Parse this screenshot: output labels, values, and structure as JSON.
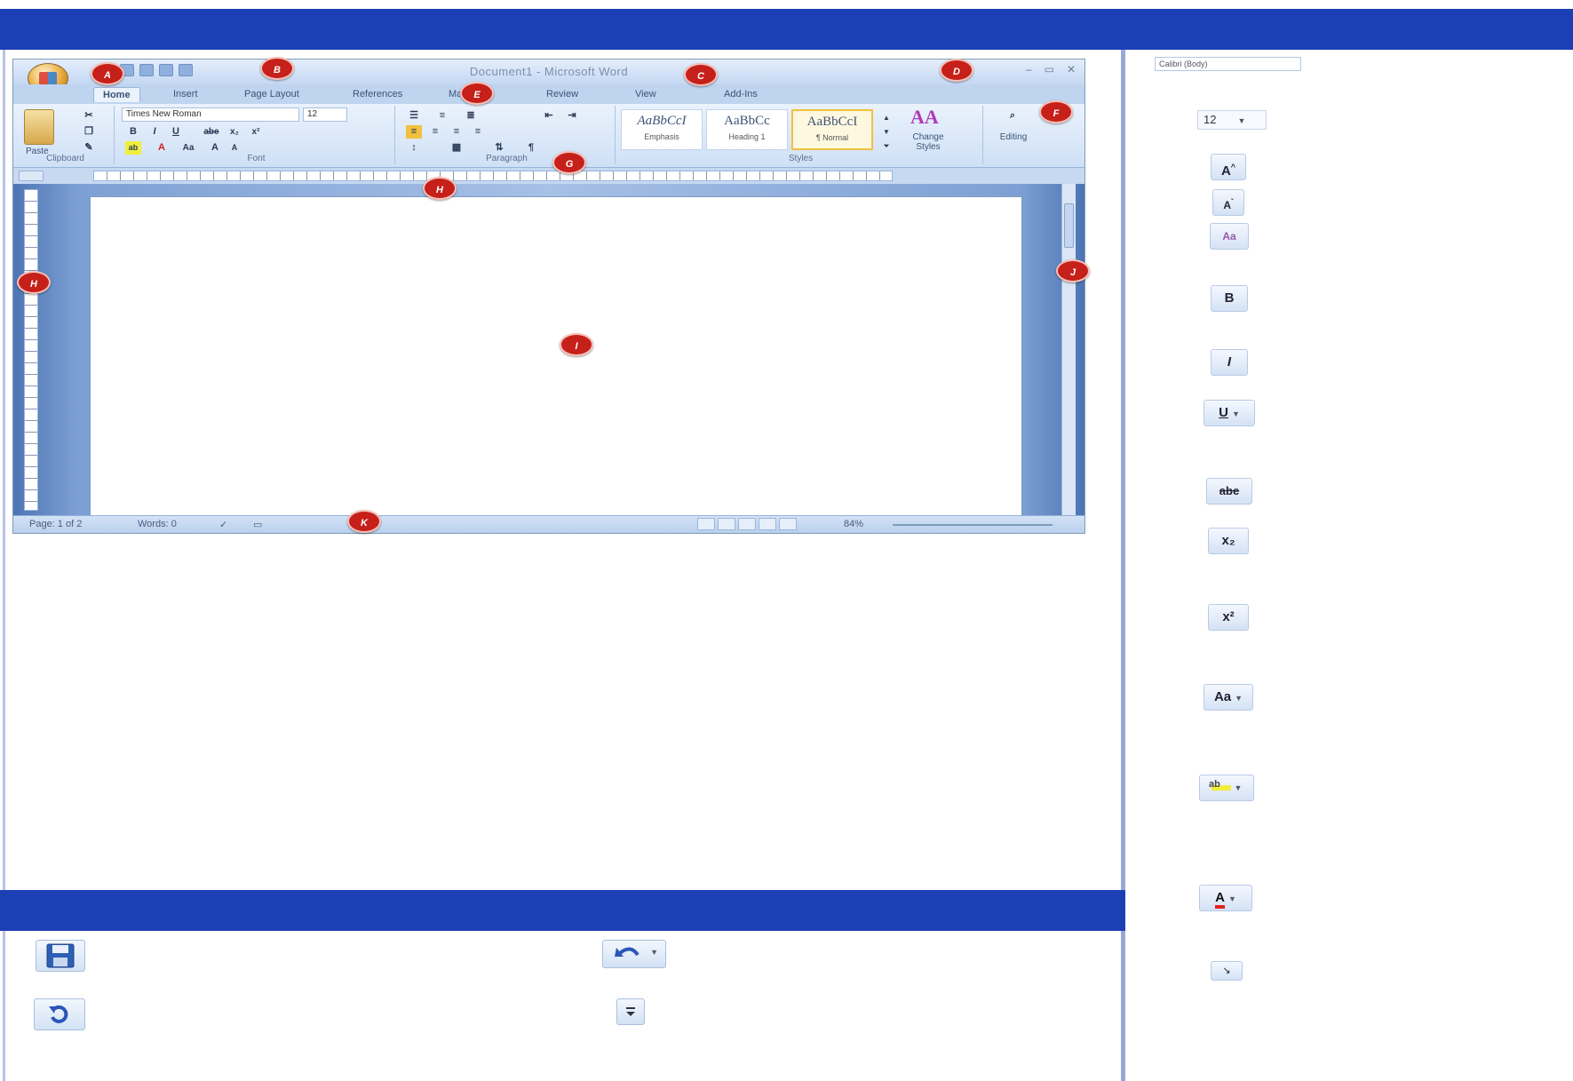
{
  "word": {
    "title": "Document1 - Microsoft Word",
    "tabs": [
      "Home",
      "Insert",
      "Page Layout",
      "References",
      "Mailings",
      "Review",
      "View",
      "Add-Ins"
    ],
    "font_name": "Times New Roman",
    "font_size": "12",
    "paste_label": "Paste",
    "group_labels": [
      "Clipboard",
      "Font",
      "Paragraph",
      "Styles"
    ],
    "styles": [
      {
        "preview": "AaBbCcI",
        "name": "Emphasis"
      },
      {
        "preview": "AaBbCc",
        "name": "Heading 1"
      },
      {
        "preview": "AaBbCcI",
        "name": "¶ Normal"
      }
    ],
    "change_styles_label": "Change Styles",
    "editing_label": "Editing",
    "status": {
      "page": "Page: 1 of 2",
      "words": "Words: 0",
      "zoom": "84%"
    }
  },
  "callouts": [
    "A",
    "B",
    "C",
    "D",
    "E",
    "F",
    "G",
    "H",
    "H",
    "I",
    "J",
    "K"
  ],
  "side": {
    "font_name": "Calibri (Body)",
    "font_size": "12",
    "buttons": {
      "grow_font": "A",
      "shrink_font": "A",
      "clear_format": "Aa",
      "bold": "B",
      "italic": "I",
      "underline": "U",
      "strikethrough": "abe",
      "subscript": "x₂",
      "superscript": "x²",
      "change_case": "Aa",
      "highlight": "ab",
      "font_color": "A",
      "dialog_launcher": "↘"
    }
  },
  "bottom": {
    "save_icon": "save-icon",
    "undo_icon": "undo-icon",
    "redo_icon": "redo-icon",
    "customize_icon": "customize-icon"
  },
  "colors": {
    "band": "#1c3fb6",
    "callout": "#c6201a"
  }
}
